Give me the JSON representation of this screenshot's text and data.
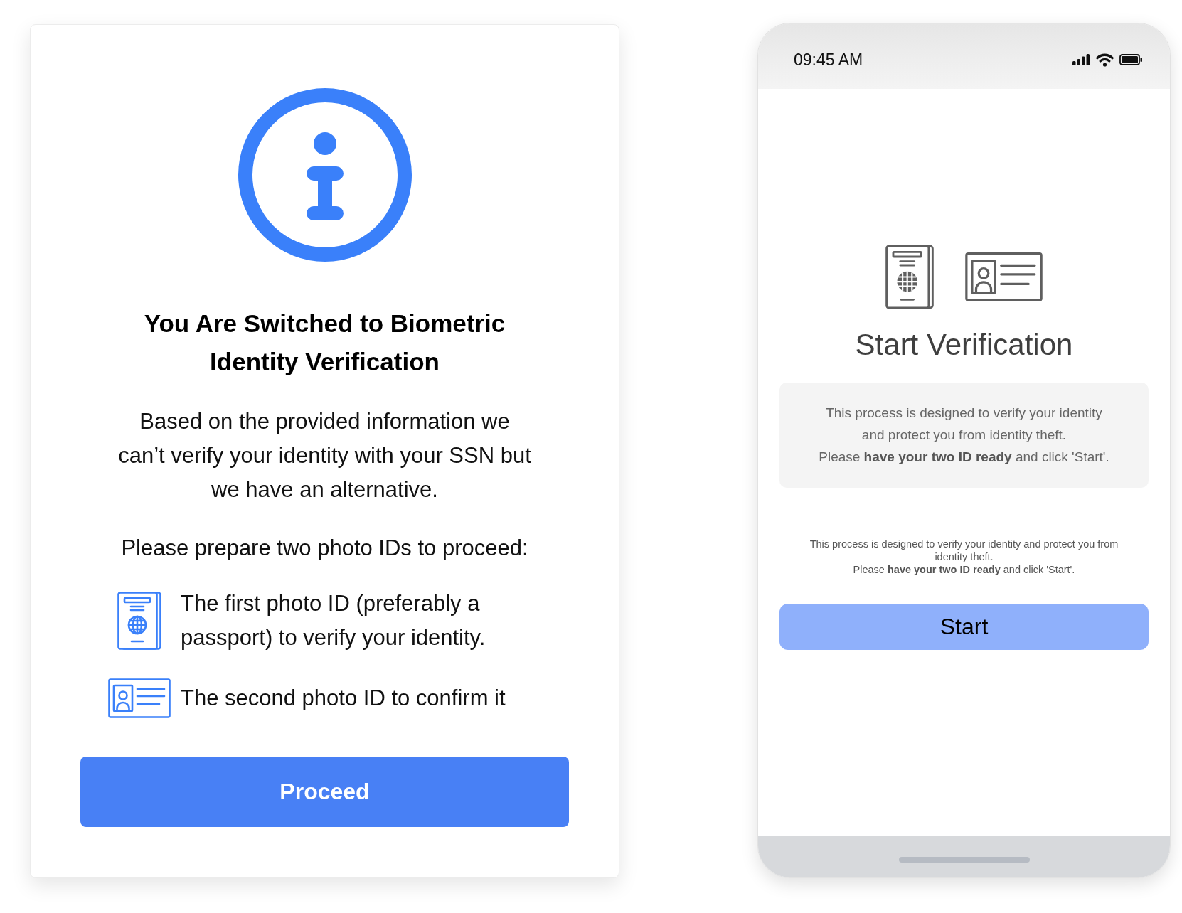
{
  "card": {
    "title": "You Are Switched to Biometric Identity Verification",
    "message": "Based on the provided information we can’t verify your identity with your SSN but we have an alternative.",
    "instruction": "Please prepare two photo IDs to proceed:",
    "id_list": [
      {
        "kind": "passport",
        "text": "The first photo ID (preferably a passport) to verify your identity."
      },
      {
        "kind": "id_card",
        "text": "The second photo ID to confirm it"
      }
    ],
    "button": "Proceed"
  },
  "phone": {
    "status_bar": {
      "time": "09:45 AM"
    },
    "title": "Start Verification",
    "info_panel": "This process is designed to verify your identity and protect you from identity theft.\nPlease **have your two ID ready** and click 'Start'.",
    "note": "This process is designed to verify your identity and protect you from identity theft.\nPlease **have your two ID ready** and click 'Start'.",
    "button": "Start"
  }
}
